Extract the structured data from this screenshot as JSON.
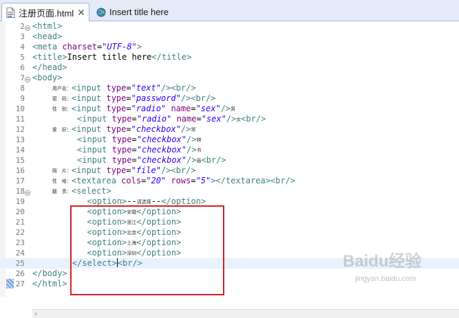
{
  "tabs": [
    {
      "label": "注册页面.html",
      "active": true,
      "close_symbol": "✕"
    },
    {
      "label": "Insert title here",
      "active": false
    }
  ],
  "editor": {
    "current_line": 25,
    "lines": [
      {
        "n": "2",
        "fold": "minus",
        "segs": [
          [
            "tag",
            "<html>"
          ]
        ]
      },
      {
        "n": "3",
        "segs": [
          [
            "tag",
            "<head>"
          ]
        ]
      },
      {
        "n": "4",
        "segs": [
          [
            "tag",
            "<meta "
          ],
          [
            "attr",
            "charset"
          ],
          [
            "txt",
            "="
          ],
          [
            "val",
            "\"UTF-8\""
          ],
          [
            "tag",
            ">"
          ]
        ]
      },
      {
        "n": "5",
        "segs": [
          [
            "tag",
            "<title>"
          ],
          [
            "txt",
            "Insert title here"
          ],
          [
            "tag",
            "</title>"
          ]
        ]
      },
      {
        "n": "6",
        "segs": [
          [
            "tag",
            "</head>"
          ]
        ]
      },
      {
        "n": "7",
        "fold": "minus",
        "segs": [
          [
            "tag",
            "<body>"
          ]
        ]
      },
      {
        "n": "8",
        "segs": [
          [
            "txt",
            "    "
          ],
          [
            "cjk",
            "用户名："
          ],
          [
            "tag",
            "<input "
          ],
          [
            "attr",
            "type"
          ],
          [
            "txt",
            "="
          ],
          [
            "val",
            "\"text\""
          ],
          [
            "tag",
            "/><br/>"
          ]
        ]
      },
      {
        "n": "9",
        "segs": [
          [
            "txt",
            "    "
          ],
          [
            "cjk",
            "密　码："
          ],
          [
            "tag",
            "<input "
          ],
          [
            "attr",
            "type"
          ],
          [
            "txt",
            "="
          ],
          [
            "val",
            "\"password\""
          ],
          [
            "tag",
            "/><br/>"
          ]
        ]
      },
      {
        "n": "10",
        "segs": [
          [
            "txt",
            "    "
          ],
          [
            "cjk",
            "性　别："
          ],
          [
            "tag",
            "<input "
          ],
          [
            "attr",
            "type"
          ],
          [
            "txt",
            "="
          ],
          [
            "val",
            "\"radio\""
          ],
          [
            "txt",
            " "
          ],
          [
            "attr",
            "name"
          ],
          [
            "txt",
            "="
          ],
          [
            "val",
            "\"sex\""
          ],
          [
            "tag",
            "/>"
          ],
          [
            "cjk",
            "男"
          ]
        ]
      },
      {
        "n": "11",
        "segs": [
          [
            "txt",
            "         "
          ],
          [
            "tag",
            "<input "
          ],
          [
            "attr",
            "type"
          ],
          [
            "txt",
            "="
          ],
          [
            "val",
            "\"radio\""
          ],
          [
            "txt",
            " "
          ],
          [
            "attr",
            "name"
          ],
          [
            "txt",
            "="
          ],
          [
            "val",
            "\"sex\""
          ],
          [
            "tag",
            "/>"
          ],
          [
            "cjk",
            "女"
          ],
          [
            "tag",
            "<br/>"
          ]
        ]
      },
      {
        "n": "12",
        "segs": [
          [
            "txt",
            "    "
          ],
          [
            "cjk",
            "爱　好："
          ],
          [
            "tag",
            "<input "
          ],
          [
            "attr",
            "type"
          ],
          [
            "txt",
            "="
          ],
          [
            "val",
            "\"checkbox\""
          ],
          [
            "tag",
            "/>"
          ],
          [
            "cjk",
            "琴"
          ]
        ]
      },
      {
        "n": "13",
        "segs": [
          [
            "txt",
            "         "
          ],
          [
            "tag",
            "<input "
          ],
          [
            "attr",
            "type"
          ],
          [
            "txt",
            "="
          ],
          [
            "val",
            "\"checkbox\""
          ],
          [
            "tag",
            "/>"
          ],
          [
            "cjk",
            "棋"
          ]
        ]
      },
      {
        "n": "14",
        "segs": [
          [
            "txt",
            "         "
          ],
          [
            "tag",
            "<input "
          ],
          [
            "attr",
            "type"
          ],
          [
            "txt",
            "="
          ],
          [
            "val",
            "\"checkbox\""
          ],
          [
            "tag",
            "/>"
          ],
          [
            "cjk",
            "书"
          ]
        ]
      },
      {
        "n": "15",
        "segs": [
          [
            "txt",
            "         "
          ],
          [
            "tag",
            "<input "
          ],
          [
            "attr",
            "type"
          ],
          [
            "txt",
            "="
          ],
          [
            "val",
            "\"checkbox\""
          ],
          [
            "tag",
            "/>"
          ],
          [
            "cjk",
            "画"
          ],
          [
            "tag",
            "<br/>"
          ]
        ]
      },
      {
        "n": "16",
        "segs": [
          [
            "txt",
            "    "
          ],
          [
            "cjk",
            "照　片："
          ],
          [
            "tag",
            "<input "
          ],
          [
            "attr",
            "type"
          ],
          [
            "txt",
            "="
          ],
          [
            "val",
            "\"file\""
          ],
          [
            "tag",
            "/><br/>"
          ]
        ]
      },
      {
        "n": "17",
        "segs": [
          [
            "txt",
            "    "
          ],
          [
            "cjk",
            "性　格："
          ],
          [
            "tag",
            "<textarea "
          ],
          [
            "attr",
            "cols"
          ],
          [
            "txt",
            "="
          ],
          [
            "val",
            "\"20\""
          ],
          [
            "txt",
            " "
          ],
          [
            "attr",
            "rows"
          ],
          [
            "txt",
            "="
          ],
          [
            "val",
            "\"5\""
          ],
          [
            "tag",
            "></textarea><br/>"
          ]
        ]
      },
      {
        "n": "18",
        "fold": "minus",
        "segs": [
          [
            "txt",
            "    "
          ],
          [
            "cjk",
            "籍　贯："
          ],
          [
            "tag",
            "<select>"
          ]
        ]
      },
      {
        "n": "19",
        "segs": [
          [
            "txt",
            "           "
          ],
          [
            "tag",
            "<option>"
          ],
          [
            "txt",
            "--"
          ],
          [
            "cjk",
            "请选择"
          ],
          [
            "txt",
            "--"
          ],
          [
            "tag",
            "</option>"
          ]
        ]
      },
      {
        "n": "20",
        "segs": [
          [
            "txt",
            "           "
          ],
          [
            "tag",
            "<option>"
          ],
          [
            "cjk",
            "安徽"
          ],
          [
            "tag",
            "</option>"
          ]
        ]
      },
      {
        "n": "21",
        "segs": [
          [
            "txt",
            "           "
          ],
          [
            "tag",
            "<option>"
          ],
          [
            "cjk",
            "浙江"
          ],
          [
            "tag",
            "</option>"
          ]
        ]
      },
      {
        "n": "22",
        "segs": [
          [
            "txt",
            "           "
          ],
          [
            "tag",
            "<option>"
          ],
          [
            "cjk",
            "北京"
          ],
          [
            "tag",
            "</option>"
          ]
        ]
      },
      {
        "n": "23",
        "segs": [
          [
            "txt",
            "           "
          ],
          [
            "tag",
            "<option>"
          ],
          [
            "cjk",
            "上海"
          ],
          [
            "tag",
            "</option>"
          ]
        ]
      },
      {
        "n": "24",
        "segs": [
          [
            "txt",
            "           "
          ],
          [
            "tag",
            "<option>"
          ],
          [
            "cjk",
            "深圳"
          ],
          [
            "tag",
            "</option>"
          ]
        ]
      },
      {
        "n": "25",
        "cursor_after": 2,
        "segs": [
          [
            "txt",
            "        "
          ],
          [
            "tag",
            "</select>"
          ],
          [
            "tag",
            "<br/>"
          ]
        ]
      },
      {
        "n": "26",
        "segs": [
          [
            "tag",
            "</body>"
          ]
        ]
      },
      {
        "n": "27",
        "segs": [
          [
            "tag",
            "</html>"
          ]
        ]
      }
    ]
  },
  "watermark": {
    "main": "Baidu经验",
    "sub": "jingyan.baidu.com"
  },
  "colors": {
    "tag": "#3f7f7f",
    "attr": "#7f007f",
    "value": "#2a00ff",
    "highlight_box": "#d42020",
    "current_line": "#e8f2fe"
  },
  "icons": {
    "file_tab": "html-file-icon",
    "close": "close-icon",
    "browser_tab": "globe-icon",
    "fold": "fold-minus-icon",
    "scroll_left": "scroll-left-arrow-icon"
  }
}
